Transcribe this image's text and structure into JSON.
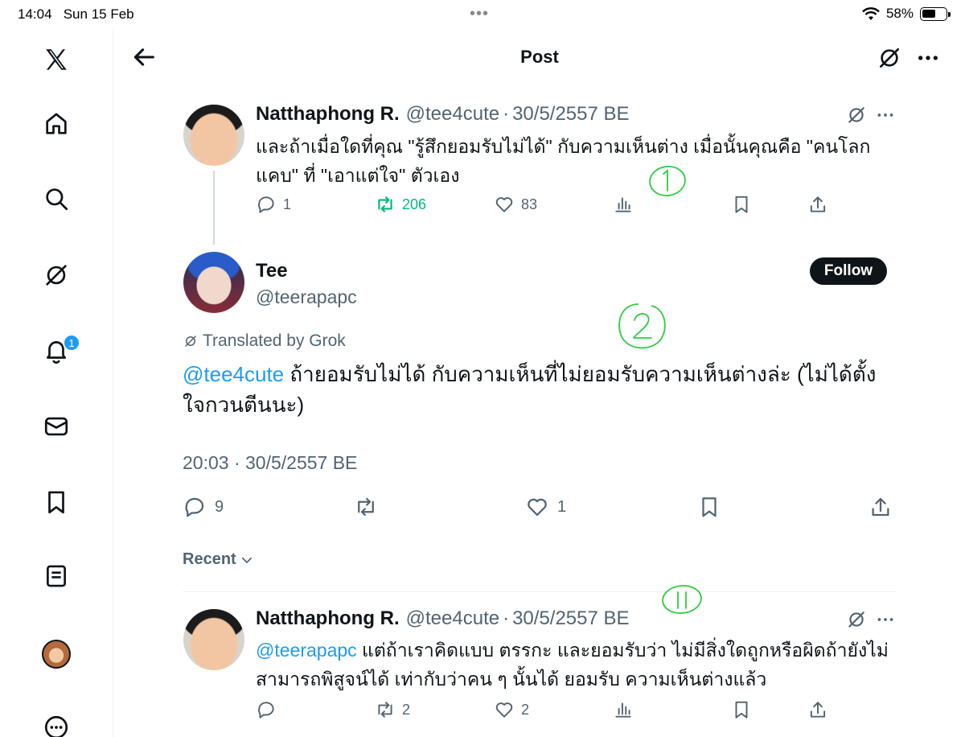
{
  "status_bar": {
    "time": "14:04",
    "date": "Sun 15 Feb",
    "dots": "•••",
    "battery": "58%",
    "battery_level": 0.58
  },
  "header": {
    "title": "Post"
  },
  "sidebar": {
    "items": [
      "x-logo",
      "home",
      "search",
      "grok",
      "notifications",
      "messages",
      "bookmarks",
      "lists",
      "profile",
      "more"
    ],
    "notification_count": "1"
  },
  "reply_parent": {
    "name": "Natthaphong R.",
    "handle": "@tee4cute",
    "sep": "·",
    "date": "30/5/2557 BE",
    "text": "และถ้าเมื่อใดที่คุณ \"รู้สึกยอมรับไม่ได้\" กับความเห็นต่าง เมื่อนั้นคุณคือ \"คนโลกแคบ\" ที่ \"เอาแต่ใจ\" ตัวเอง",
    "replies": "1",
    "retweets": "206",
    "likes": "83"
  },
  "main_post": {
    "name": "Tee",
    "handle": "@teerapapc",
    "follow_label": "Follow",
    "translated_label": "Translated by Grok",
    "mention": "@tee4cute",
    "text": " ถ้ายอมรับไม่ได้ กับความเห็นที่ไม่ยอมรับความเห็นต่างล่ะ (ไม่ได้ตั้ง ใจกวนตีนนะ)",
    "timestamp": "20:03 · 30/5/2557 BE",
    "replies": "9",
    "retweets": "",
    "likes": "1"
  },
  "sort": {
    "label": "Recent"
  },
  "reply": {
    "name": "Natthaphong R.",
    "handle": "@tee4cute",
    "sep": "·",
    "date": "30/5/2557 BE",
    "mention": "@teerapapc",
    "text": " แต่ถ้าเราคิดแบบ ตรรกะ และยอมรับว่า ไม่มีสิ่งใดถูกหรือผิดถ้ายังไม่สามารถพิสูจน์ได้ เท่ากับว่าคน ๆ นั้นได้ ยอมรับ ความเห็นต่างแล้ว",
    "replies": "",
    "retweets": "2",
    "likes": "2"
  },
  "colors": {
    "accent": "#1d9bf0",
    "retweet_green": "#00ba7c",
    "text": "#0f1419",
    "muted": "#536471",
    "annotation": "#2ecc40"
  }
}
